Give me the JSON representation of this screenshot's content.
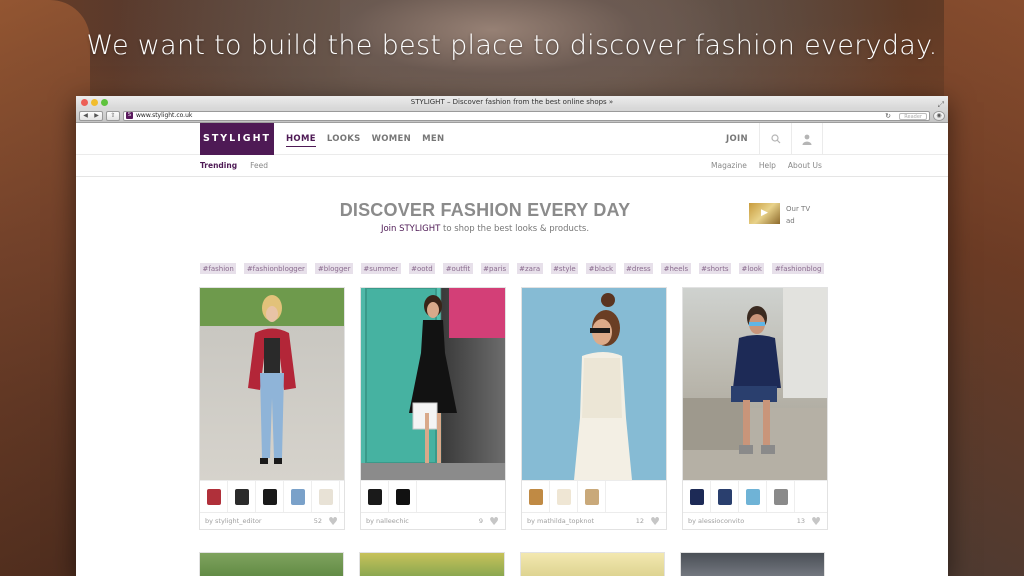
{
  "headline": "We want to build the best place to discover fashion everyday.",
  "browser": {
    "title": "STYLIGHT – Discover fashion from the best online shops »",
    "url": "www.stylight.co.uk",
    "favicon": "S",
    "reader_label": "Reader"
  },
  "header": {
    "logo": "STYLIGHT",
    "nav": [
      "HOME",
      "LOOKS",
      "WOMEN",
      "MEN"
    ],
    "join": "JOIN"
  },
  "subnav": {
    "left": [
      "Trending",
      "Feed"
    ],
    "right": [
      "Magazine",
      "Help",
      "About Us"
    ]
  },
  "hero": {
    "title": "DISCOVER FASHION EVERY DAY",
    "link": "Join STYLIGHT",
    "rest": " to shop the best looks & products.",
    "tvad": "Our TV ad"
  },
  "tags": [
    "#fashion",
    "#fashionblogger",
    "#blogger",
    "#summer",
    "#ootd",
    "#outfit",
    "#paris",
    "#zara",
    "#style",
    "#black",
    "#dress",
    "#heels",
    "#shorts",
    "#look",
    "#fashionblog"
  ],
  "cards": [
    {
      "author": "by stylight_editor",
      "likes": "52",
      "items": [
        "#b0303a",
        "#2b2b2b",
        "#1a1a1a",
        "#7aa1c9",
        "#e8e2d6"
      ]
    },
    {
      "author": "by nalleechic",
      "likes": "9",
      "items": [
        "#1a1a1a",
        "#111111"
      ]
    },
    {
      "author": "by mathilda_topknot",
      "likes": "12",
      "items": [
        "#c08a44",
        "#efe6d4",
        "#c9a97a"
      ]
    },
    {
      "author": "by alessioconvito",
      "likes": "13",
      "items": [
        "#1d2a56",
        "#2a3f6e",
        "#6fb3d6",
        "#8a8a8a"
      ]
    }
  ]
}
